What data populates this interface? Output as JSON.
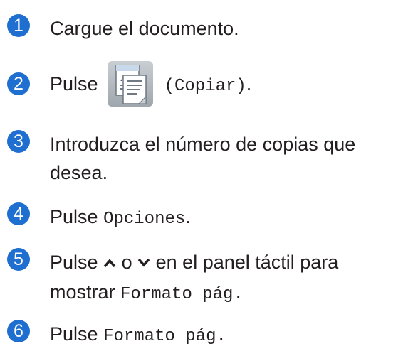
{
  "colors": {
    "badge": "#1f6fd1",
    "text": "#231f20"
  },
  "steps": [
    {
      "number": "1",
      "text": "Cargue el documento."
    },
    {
      "number": "2",
      "prefix": "Pulse",
      "icon": "copy-icon",
      "button": "(Copiar)",
      "suffix": "."
    },
    {
      "number": "3",
      "line1": "Introduzca el número de copias que",
      "line2": "desea."
    },
    {
      "number": "4",
      "prefix": "Pulse",
      "button": "Opciones",
      "suffix": "."
    },
    {
      "number": "5",
      "prefix": "Pulse",
      "up_icon": "chevron-up-icon",
      "connector": "o",
      "down_icon": "chevron-down-icon",
      "rest": "en el panel táctil para",
      "line2_prefix": "mostrar",
      "button": "Formato pág.",
      "suffix": "."
    },
    {
      "number": "6",
      "prefix": "Pulse",
      "button": "Formato pág.",
      "suffix": "."
    }
  ]
}
